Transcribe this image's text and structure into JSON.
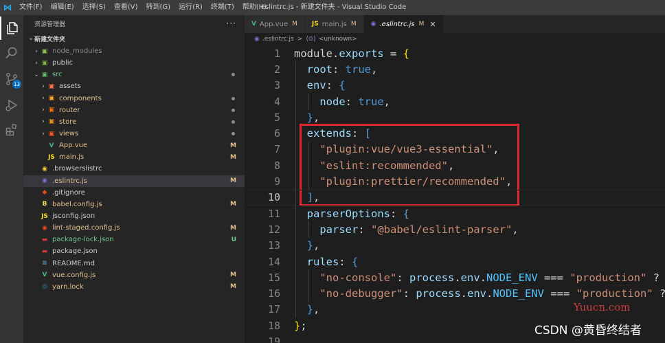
{
  "window": {
    "title": ".eslintrc.js - 新建文件夹 - Visual Studio Code",
    "menu": [
      "文件(F)",
      "编辑(E)",
      "选择(S)",
      "查看(V)",
      "转到(G)",
      "运行(R)",
      "终端(T)",
      "帮助(H)"
    ]
  },
  "activity": {
    "scm_badge": "13",
    "icons": [
      "files-icon",
      "search-icon",
      "source-control-icon",
      "run-debug-icon",
      "extensions-icon"
    ]
  },
  "sidebar": {
    "header": "资源管理器",
    "more": "···",
    "folder": "新建文件夹",
    "items": [
      {
        "name": "node_modules",
        "depth": 1,
        "type": "folder",
        "icon": "▣",
        "color": "#8bc34a",
        "status": "",
        "dot": false,
        "nameColor": "#8c8c8c"
      },
      {
        "name": "public",
        "depth": 1,
        "type": "folder",
        "icon": "▣",
        "color": "#7cb342",
        "status": "",
        "dot": false,
        "nameColor": ""
      },
      {
        "name": "src",
        "depth": 1,
        "type": "folder-open",
        "icon": "▣",
        "color": "#66bb6a",
        "status": "",
        "dot": true,
        "nameColor": "#73c991"
      },
      {
        "name": "assets",
        "depth": 2,
        "type": "folder",
        "icon": "▣",
        "color": "#ff7043",
        "status": "",
        "dot": false,
        "nameColor": ""
      },
      {
        "name": "components",
        "depth": 2,
        "type": "folder",
        "icon": "▣",
        "color": "#ffa726",
        "status": "",
        "dot": true,
        "nameColor": "#e2c08d"
      },
      {
        "name": "router",
        "depth": 2,
        "type": "folder",
        "icon": "▣",
        "color": "#ef6c00",
        "status": "",
        "dot": true,
        "nameColor": "#e2c08d"
      },
      {
        "name": "store",
        "depth": 2,
        "type": "folder",
        "icon": "▣",
        "color": "#ef8c1a",
        "status": "",
        "dot": true,
        "nameColor": "#e2c08d"
      },
      {
        "name": "views",
        "depth": 2,
        "type": "folder",
        "icon": "▣",
        "color": "#ff5722",
        "status": "",
        "dot": true,
        "nameColor": "#e2c08d"
      },
      {
        "name": "App.vue",
        "depth": 2,
        "type": "file",
        "icon": "V",
        "color": "#41b883",
        "status": "M",
        "dot": false,
        "nameColor": "#e2c08d"
      },
      {
        "name": "main.js",
        "depth": 2,
        "type": "file",
        "icon": "JS",
        "color": "#f5de19",
        "status": "M",
        "dot": false,
        "nameColor": "#e2c08d"
      },
      {
        "name": ".browserslistrc",
        "depth": 1,
        "type": "file",
        "icon": "◉",
        "color": "#ffca28",
        "status": "",
        "dot": false,
        "nameColor": ""
      },
      {
        "name": ".eslintrc.js",
        "depth": 1,
        "type": "file",
        "icon": "◉",
        "color": "#8d6bd6",
        "status": "M",
        "dot": false,
        "nameColor": "#e2c08d",
        "selected": true
      },
      {
        "name": ".gitignore",
        "depth": 1,
        "type": "file",
        "icon": "◆",
        "color": "#e64a19",
        "status": "",
        "dot": false,
        "nameColor": ""
      },
      {
        "name": "babel.config.js",
        "depth": 1,
        "type": "file",
        "icon": "B",
        "color": "#f5da55",
        "status": "M",
        "dot": false,
        "nameColor": "#e2c08d"
      },
      {
        "name": "jsconfig.json",
        "depth": 1,
        "type": "file",
        "icon": "JS",
        "color": "#f5de19",
        "status": "",
        "dot": false,
        "nameColor": ""
      },
      {
        "name": "lint-staged.config.js",
        "depth": 1,
        "type": "file",
        "icon": "◉",
        "color": "#e64a19",
        "status": "M",
        "dot": false,
        "nameColor": "#e2c08d"
      },
      {
        "name": "package-lock.json",
        "depth": 1,
        "type": "file",
        "icon": "▬",
        "color": "#cb3837",
        "status": "U",
        "dot": false,
        "nameColor": "#73c991"
      },
      {
        "name": "package.json",
        "depth": 1,
        "type": "file",
        "icon": "▬",
        "color": "#cb3837",
        "status": "",
        "dot": false,
        "nameColor": ""
      },
      {
        "name": "README.md",
        "depth": 1,
        "type": "file",
        "icon": "≡",
        "color": "#519aba",
        "status": "",
        "dot": false,
        "nameColor": ""
      },
      {
        "name": "vue.config.js",
        "depth": 1,
        "type": "file",
        "icon": "V",
        "color": "#41b883",
        "status": "M",
        "dot": false,
        "nameColor": "#e2c08d"
      },
      {
        "name": "yarn.lock",
        "depth": 1,
        "type": "file",
        "icon": "◎",
        "color": "#2c8ebb",
        "status": "M",
        "dot": false,
        "nameColor": "#e2c08d"
      }
    ]
  },
  "tabs": [
    {
      "icon": "V",
      "iconColor": "#41b883",
      "label": "App.vue",
      "status": "M",
      "active": false
    },
    {
      "icon": "JS",
      "iconColor": "#f5de19",
      "label": "main.js",
      "status": "M",
      "active": false
    },
    {
      "icon": "◉",
      "iconColor": "#8d6bd6",
      "label": ".eslintrc.js",
      "status": "M",
      "active": true
    }
  ],
  "breadcrumb": {
    "file": ".eslintrc.js",
    "separator": ">",
    "symbol_icon": "⟨⊙⟩",
    "symbol": "<unknown>"
  },
  "editor": {
    "current_line": 10,
    "lines": [
      {
        "n": "1",
        "tokens": [
          [
            "module",
            "t-id"
          ],
          [
            ".",
            "t-id"
          ],
          [
            "exports",
            "t-prop"
          ],
          [
            " = ",
            "t-id"
          ],
          [
            "{",
            "t-brace"
          ]
        ]
      },
      {
        "n": "2",
        "tokens": [
          [
            "  root",
            "t-prop"
          ],
          [
            ": ",
            "t-id"
          ],
          [
            "true",
            "t-kw"
          ],
          [
            ",",
            "t-id"
          ]
        ]
      },
      {
        "n": "3",
        "tokens": [
          [
            "  env",
            "t-prop"
          ],
          [
            ": ",
            "t-id"
          ],
          [
            "{",
            "t-kw"
          ]
        ]
      },
      {
        "n": "4",
        "tokens": [
          [
            "    node",
            "t-prop"
          ],
          [
            ": ",
            "t-id"
          ],
          [
            "true",
            "t-kw"
          ],
          [
            ",",
            "t-id"
          ]
        ]
      },
      {
        "n": "5",
        "tokens": [
          [
            "  ",
            "t-id"
          ],
          [
            "}",
            "t-kw"
          ],
          [
            ",",
            "t-id"
          ]
        ]
      },
      {
        "n": "6",
        "tokens": [
          [
            "  extends",
            "t-prop"
          ],
          [
            ": ",
            "t-id"
          ],
          [
            "[",
            "t-kw"
          ]
        ]
      },
      {
        "n": "7",
        "tokens": [
          [
            "    ",
            "t-id"
          ],
          [
            "\"plugin:vue/vue3-essential\"",
            "t-str"
          ],
          [
            ",",
            "t-id"
          ]
        ]
      },
      {
        "n": "8",
        "tokens": [
          [
            "    ",
            "t-id"
          ],
          [
            "\"eslint:recommended\"",
            "t-str"
          ],
          [
            ",",
            "t-id"
          ]
        ]
      },
      {
        "n": "9",
        "tokens": [
          [
            "    ",
            "t-id"
          ],
          [
            "\"plugin:prettier/recommended\"",
            "t-str"
          ],
          [
            ",",
            "t-id"
          ]
        ]
      },
      {
        "n": "10",
        "tokens": [
          [
            "  ",
            "t-id"
          ],
          [
            "]",
            "t-kw"
          ],
          [
            ",",
            "t-id"
          ]
        ]
      },
      {
        "n": "11",
        "tokens": [
          [
            "  parserOptions",
            "t-prop"
          ],
          [
            ": ",
            "t-id"
          ],
          [
            "{",
            "t-kw"
          ]
        ]
      },
      {
        "n": "12",
        "tokens": [
          [
            "    parser",
            "t-prop"
          ],
          [
            ": ",
            "t-id"
          ],
          [
            "\"@babel/eslint-parser\"",
            "t-str"
          ],
          [
            ",",
            "t-id"
          ]
        ]
      },
      {
        "n": "13",
        "tokens": [
          [
            "  ",
            "t-id"
          ],
          [
            "}",
            "t-kw"
          ],
          [
            ",",
            "t-id"
          ]
        ]
      },
      {
        "n": "14",
        "tokens": [
          [
            "  rules",
            "t-prop"
          ],
          [
            ": ",
            "t-id"
          ],
          [
            "{",
            "t-kw"
          ]
        ]
      },
      {
        "n": "15",
        "tokens": [
          [
            "    ",
            "t-id"
          ],
          [
            "\"no-console\"",
            "t-str"
          ],
          [
            ": ",
            "t-id"
          ],
          [
            "process",
            "t-prop"
          ],
          [
            ".",
            "t-id"
          ],
          [
            "env",
            "t-prop"
          ],
          [
            ".",
            "t-id"
          ],
          [
            "NODE_ENV",
            "t-const"
          ],
          [
            " === ",
            "t-id"
          ],
          [
            "\"production\"",
            "t-str"
          ],
          [
            " ?",
            "t-id"
          ]
        ]
      },
      {
        "n": "16",
        "tokens": [
          [
            "    ",
            "t-id"
          ],
          [
            "\"no-debugger\"",
            "t-str"
          ],
          [
            ": ",
            "t-id"
          ],
          [
            "process",
            "t-prop"
          ],
          [
            ".",
            "t-id"
          ],
          [
            "env",
            "t-prop"
          ],
          [
            ".",
            "t-id"
          ],
          [
            "NODE_ENV",
            "t-const"
          ],
          [
            " === ",
            "t-id"
          ],
          [
            "\"production\"",
            "t-str"
          ],
          [
            " ?",
            "t-id"
          ]
        ]
      },
      {
        "n": "17",
        "tokens": [
          [
            "  ",
            "t-id"
          ],
          [
            "}",
            "t-kw"
          ],
          [
            ",",
            "t-id"
          ]
        ]
      },
      {
        "n": "18",
        "tokens": [
          [
            "}",
            "t-brace"
          ],
          [
            ";",
            "t-id"
          ]
        ]
      },
      {
        "n": "19",
        "tokens": []
      }
    ]
  },
  "watermarks": {
    "site": "Yuucn.com",
    "credit": "CSDN @黄昏终结者"
  }
}
